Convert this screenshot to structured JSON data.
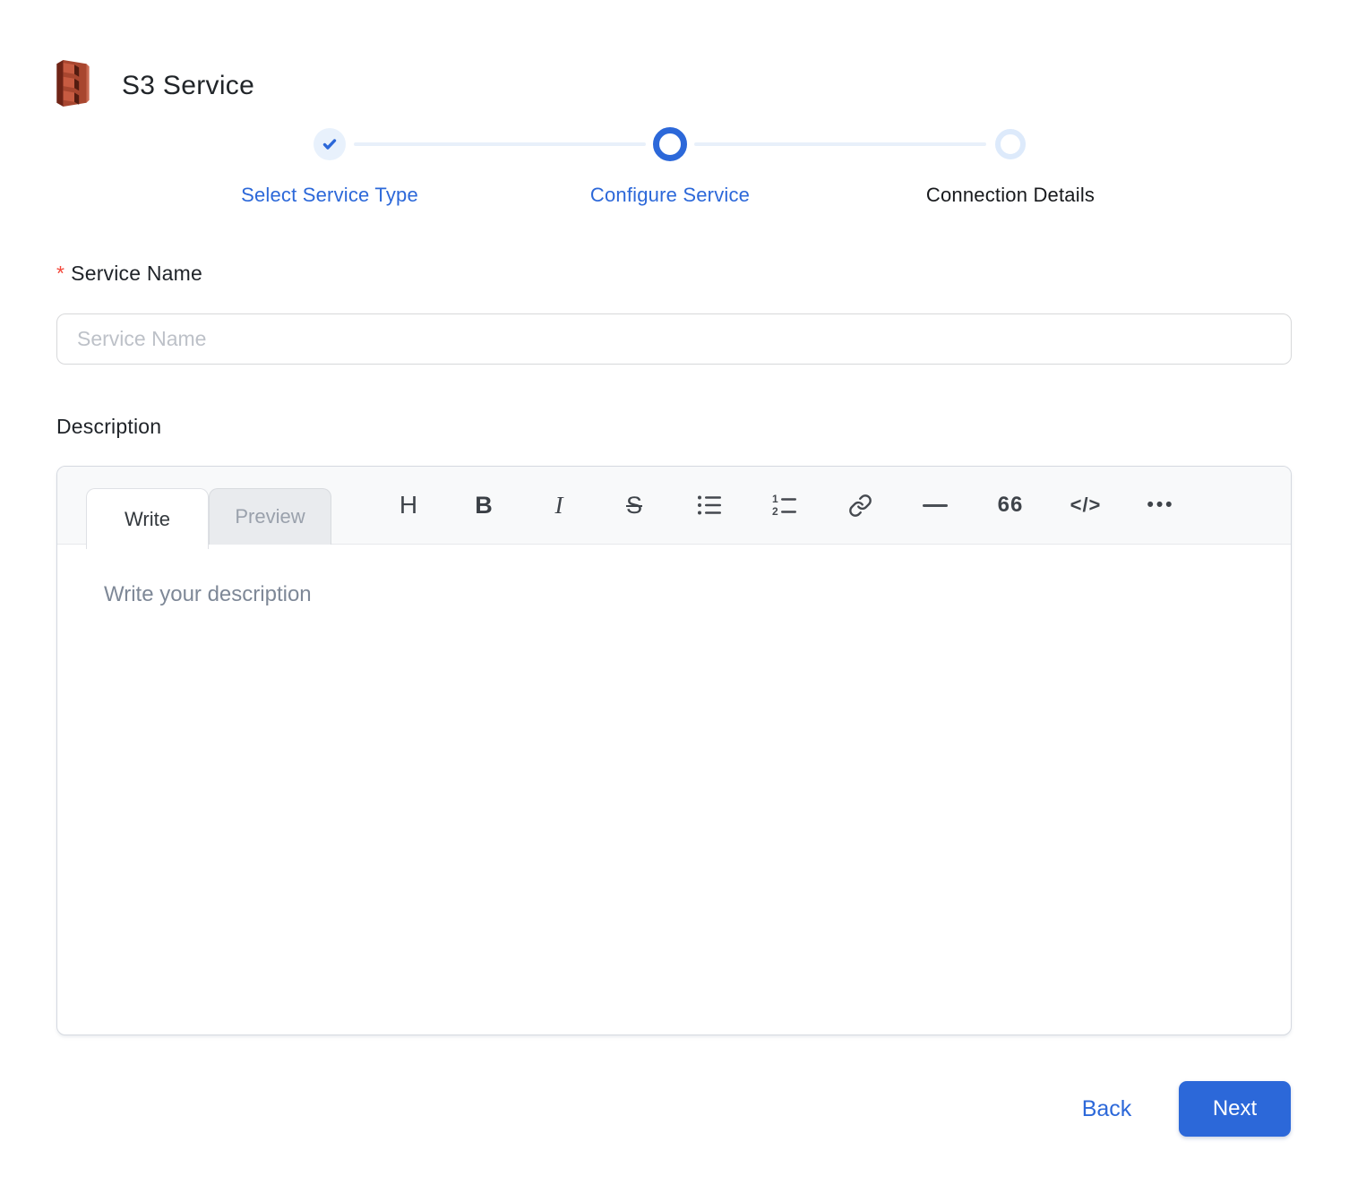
{
  "header": {
    "title": "S3 Service",
    "icon": "s3-service"
  },
  "stepper": {
    "steps": [
      {
        "label": "Select Service Type",
        "state": "completed"
      },
      {
        "label": "Configure Service",
        "state": "active"
      },
      {
        "label": "Connection Details",
        "state": "pending"
      }
    ]
  },
  "form": {
    "service_name": {
      "required_marker": "*",
      "label": "Service Name",
      "placeholder": "Service Name",
      "value": ""
    },
    "description": {
      "label": "Description",
      "editor": {
        "tabs": [
          {
            "label": "Write",
            "active": true
          },
          {
            "label": "Preview",
            "active": false
          }
        ],
        "toolbar": {
          "heading": "H",
          "bold": "B",
          "italic": "I",
          "strikethrough": "S",
          "bulleted_list": "bulleted-list-icon",
          "numbered_list": "numbered-list-icon",
          "link": "link-icon",
          "horizontal_rule": "horizontal-rule-icon",
          "quote": "66",
          "code": "</>",
          "more": "•••"
        },
        "placeholder": "Write your description",
        "value": ""
      }
    }
  },
  "footer": {
    "back_label": "Back",
    "next_label": "Next"
  },
  "colors": {
    "accent_blue": "#2c68d9",
    "step_light_blue": "#e8f1fc",
    "connector_blue": "#e8f0fa",
    "pending_ring": "#ddeafb",
    "required_red": "#f4483b",
    "s3_red_body": "#a8462f",
    "s3_red_dark": "#6f2416",
    "border_gray": "#d7d8da",
    "toolbar_bg": "#f8f9fa",
    "toolbar_icon": "#45494f",
    "tab_inactive_bg": "#e9ebee",
    "input_placeholder": "#bdc1c8",
    "editor_placeholder": "#7e8897",
    "next_button_bg": "#2c68d9"
  }
}
